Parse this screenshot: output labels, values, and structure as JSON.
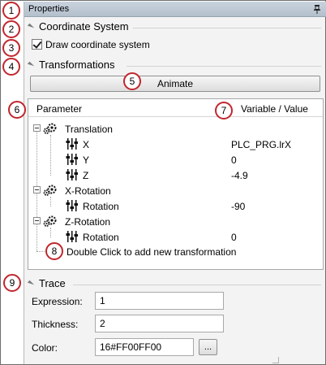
{
  "window": {
    "title": "Properties"
  },
  "coordinate_system": {
    "heading": "Coordinate System",
    "draw_checkbox_label": "Draw coordinate system",
    "draw_checked": true
  },
  "transformations": {
    "heading": "Transformations",
    "animate_label": "Animate",
    "columns": {
      "parameter": "Parameter",
      "value": "Variable / Value"
    },
    "groups": [
      {
        "label": "Translation",
        "params": [
          {
            "name": "X",
            "value": "PLC_PRG.lrX"
          },
          {
            "name": "Y",
            "value": "0"
          },
          {
            "name": "Z",
            "value": "-4.9"
          }
        ]
      },
      {
        "label": "X-Rotation",
        "params": [
          {
            "name": "Rotation",
            "value": "-90"
          }
        ]
      },
      {
        "label": "Z-Rotation",
        "params": [
          {
            "name": "Rotation",
            "value": "0"
          }
        ]
      }
    ],
    "add_hint": "Double Click to add new transformation"
  },
  "trace": {
    "heading": "Trace",
    "expression_label": "Expression:",
    "expression_value": "1",
    "thickness_label": "Thickness:",
    "thickness_value": "2",
    "color_label": "Color:",
    "color_value": "16#FF00FF00",
    "ellipsis_label": "..."
  },
  "callouts": [
    "1",
    "2",
    "3",
    "4",
    "5",
    "6",
    "7",
    "8",
    "9"
  ],
  "colors": {
    "callout_ring": "#c0262d",
    "titlebar": "#b9c4d1",
    "panel": "#f3f3f3"
  }
}
